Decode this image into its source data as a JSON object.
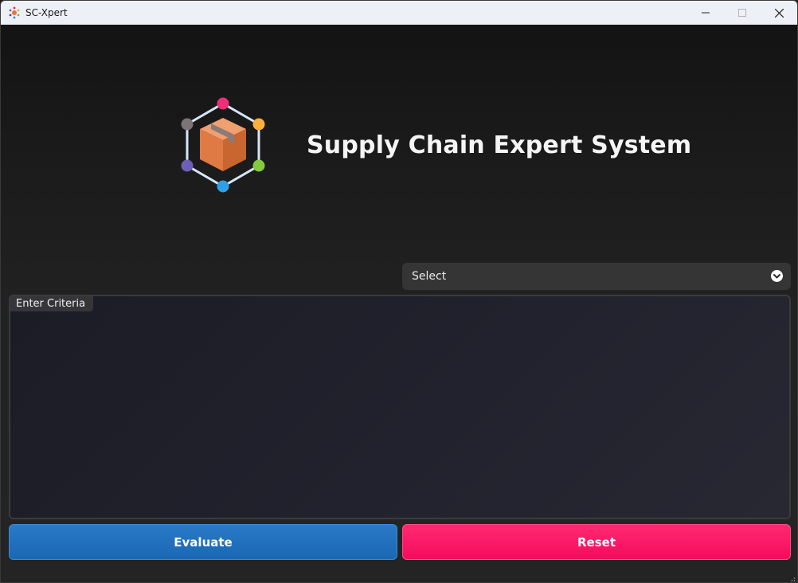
{
  "window": {
    "title": "SC-Xpert"
  },
  "header": {
    "title": "Supply Chain Expert System",
    "logo_icon": "package-network-icon"
  },
  "select": {
    "selected": "Select",
    "icon": "chevron-down-circle-icon"
  },
  "criteria": {
    "label": "Enter Criteria",
    "value": ""
  },
  "actions": {
    "evaluate_label": "Evaluate",
    "reset_label": "Reset"
  },
  "colors": {
    "evaluate": "#1f70bd",
    "reset": "#ff1464",
    "background": "#1f1f1f",
    "titlebar": "#eef0f7"
  }
}
